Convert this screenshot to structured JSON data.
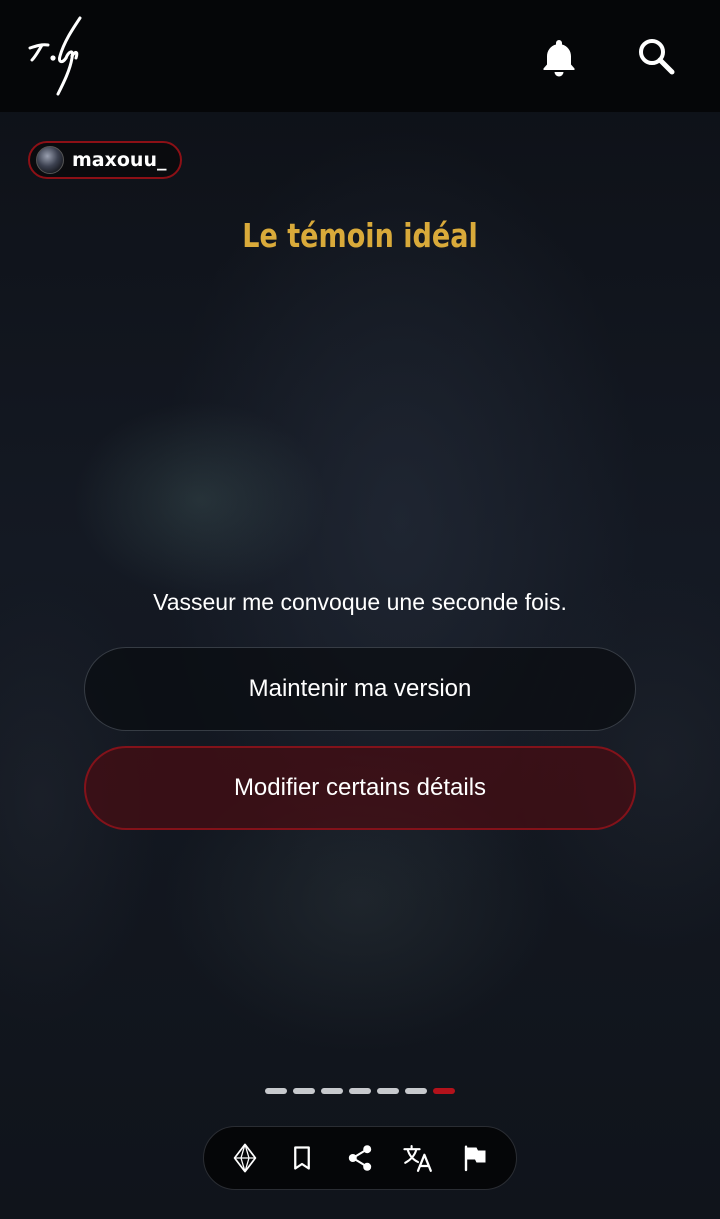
{
  "header": {
    "logo_icon": "script-logo-icon",
    "notifications_icon": "bell-icon",
    "search_icon": "search-icon"
  },
  "author": {
    "username": "maxouu_"
  },
  "story": {
    "title": "Le témoin idéal",
    "narration": "Vasseur me convoque une seconde fois."
  },
  "choices": [
    {
      "label": "Maintenir ma version"
    },
    {
      "label": "Modifier certains détails"
    }
  ],
  "progress": {
    "total_steps": 7,
    "current_step": 7
  },
  "actions": [
    {
      "icon": "diamond-icon"
    },
    {
      "icon": "bookmark-icon"
    },
    {
      "icon": "share-icon"
    },
    {
      "icon": "translate-icon"
    },
    {
      "icon": "flag-icon"
    }
  ],
  "colors": {
    "title": "#d9aa3a",
    "accent_red": "#b3121b",
    "top_bar": "#050608"
  }
}
